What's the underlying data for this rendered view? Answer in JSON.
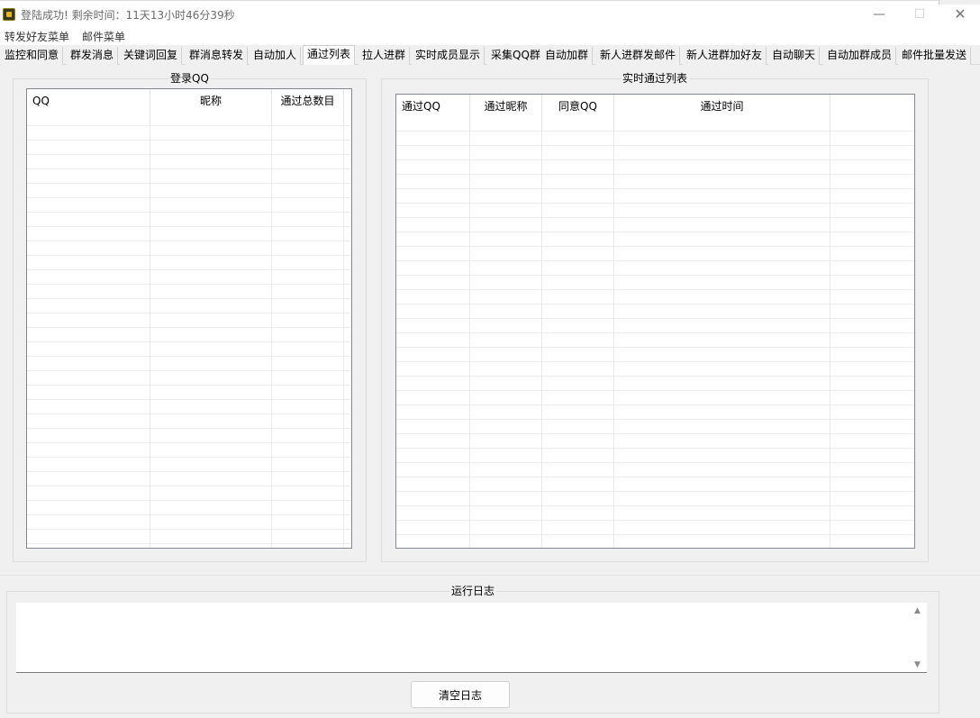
{
  "window": {
    "title": "登陆成功! 剩余时间：11天13小时46分39秒",
    "controls": {
      "minimize": "—",
      "maximize": "☐",
      "close": "✕"
    }
  },
  "menu": {
    "items": [
      "转发好友菜单",
      "邮件菜单"
    ]
  },
  "tabs": {
    "active": "通过列表",
    "items": [
      "监控和同意",
      "群发消息",
      "关键词回复",
      "群消息转发",
      "自动加人",
      "通过列表",
      "拉人进群",
      "实时成员显示",
      "采集QQ群",
      "自动加群",
      "新人进群发邮件",
      "新人进群加好友",
      "自动聊天",
      "自动加群成员",
      "邮件批量发送"
    ]
  },
  "login_group": {
    "title": "登录QQ",
    "columns": [
      "QQ",
      "昵称",
      "通过总数目"
    ]
  },
  "pass_group": {
    "title": "实时通过列表",
    "columns": [
      "通过QQ",
      "通过昵称",
      "同意QQ",
      "通过时间",
      ""
    ]
  },
  "log": {
    "title": "运行日志",
    "content": "",
    "clear_button": "清空日志"
  },
  "icons": {
    "app": "app-icon",
    "scroll_up": "scroll-up-arrow-icon",
    "scroll_down": "scroll-down-arrow-icon"
  }
}
